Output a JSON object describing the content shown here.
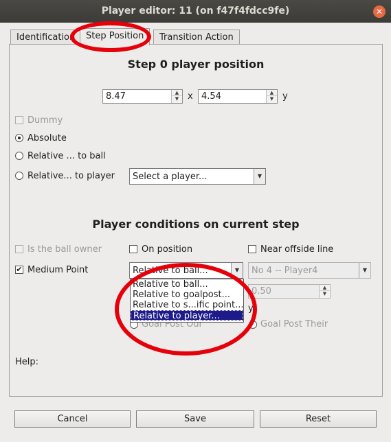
{
  "window": {
    "title": "Player editor: 11 (on f47f4fdcc9fe)"
  },
  "tabs": [
    "Identification",
    "Step Position",
    "Transition Action"
  ],
  "step_heading": "Step 0 player position",
  "position": {
    "x_value": "8.47",
    "x_label": "x",
    "y_value": "4.54",
    "y_label": "y"
  },
  "options": {
    "dummy": "Dummy",
    "absolute": "Absolute",
    "relative_ball": "Relative ... to ball",
    "relative_player": "Relative... to player",
    "player_select": "Select a player..."
  },
  "conditions_heading": "Player conditions on current step",
  "conditions": {
    "ball_owner": "Is the ball owner",
    "on_position": "On position",
    "near_offside": "Near offside line",
    "medium_point": "Medium Point",
    "relative_combo": "Relative to ball...",
    "player_combo": "No 4  -- Player4",
    "value_spin": "0.50",
    "y_label": "y",
    "goal_post_our": "Goal Post Our",
    "goal_post_their": "Goal Post Their"
  },
  "dropdown_items": [
    "Relative to ball...",
    "Relative to goalpost...",
    "Relative to s...ific point...",
    "Relative to player..."
  ],
  "help_label": "Help:",
  "buttons": {
    "cancel": "Cancel",
    "save": "Save",
    "reset": "Reset"
  },
  "colors": {
    "accent_red": "#e6000a",
    "selection": "#1d1a8a",
    "titlebar": "#3c3b37",
    "close": "#e66a42"
  }
}
